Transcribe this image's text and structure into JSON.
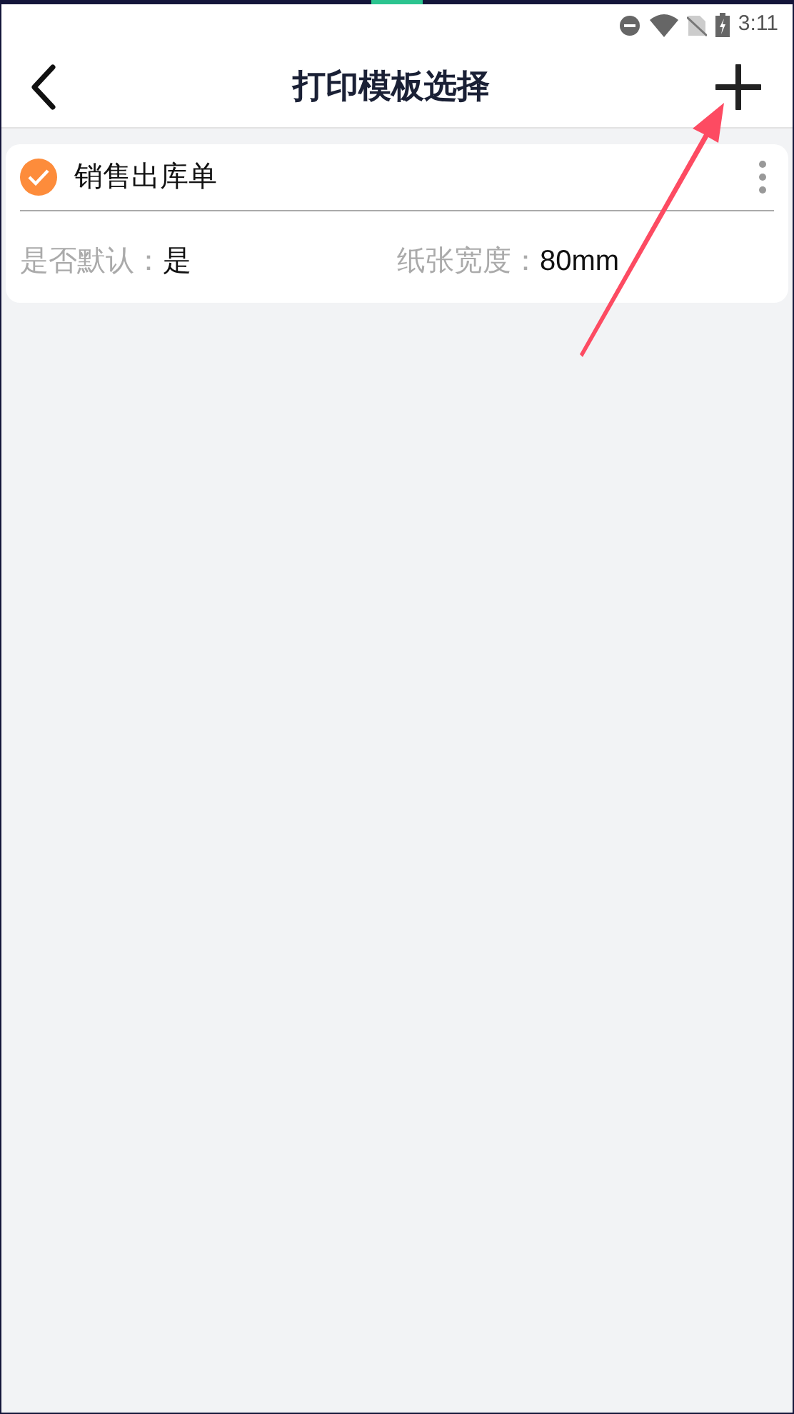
{
  "status_bar": {
    "time": "3:11"
  },
  "header": {
    "title": "打印模板选择"
  },
  "templates": [
    {
      "name": "销售出库单",
      "checked": true,
      "fields": [
        {
          "label": "是否默认：",
          "value": "是"
        },
        {
          "label": "纸张宽度：",
          "value": "80mm"
        }
      ]
    }
  ]
}
